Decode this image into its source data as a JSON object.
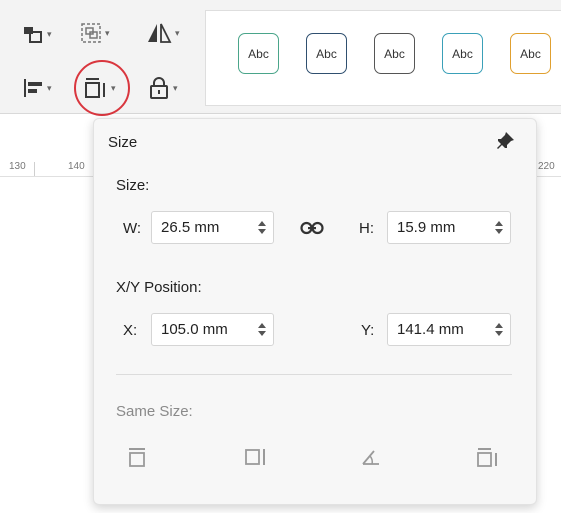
{
  "toolbar": {
    "buttons": [
      {
        "name": "arrange-icon"
      },
      {
        "name": "group-icon"
      },
      {
        "name": "flip-icon"
      },
      {
        "name": "align-icon"
      },
      {
        "name": "size-icon"
      },
      {
        "name": "lock-icon"
      }
    ],
    "styles": [
      {
        "label": "Abc",
        "border": "#4aa58a"
      },
      {
        "label": "Abc",
        "border": "#2f4f6f"
      },
      {
        "label": "Abc",
        "border": "#555555"
      },
      {
        "label": "Abc",
        "border": "#3aa0b8"
      },
      {
        "label": "Abc",
        "border": "#e0a030"
      }
    ]
  },
  "ruler": {
    "labels": [
      "130",
      "140",
      "220"
    ]
  },
  "panel": {
    "title": "Size",
    "size_label": "Size:",
    "w_label": "W:",
    "w_value": "26.5 mm",
    "h_label": "H:",
    "h_value": "15.9 mm",
    "position_label": "X/Y Position:",
    "x_label": "X:",
    "x_value": "105.0 mm",
    "y_label": "Y:",
    "y_value": "141.4 mm",
    "same_size_label": "Same Size:"
  },
  "colors": {
    "highlight": "#d9363e",
    "disabled": "#9a9a9a"
  }
}
